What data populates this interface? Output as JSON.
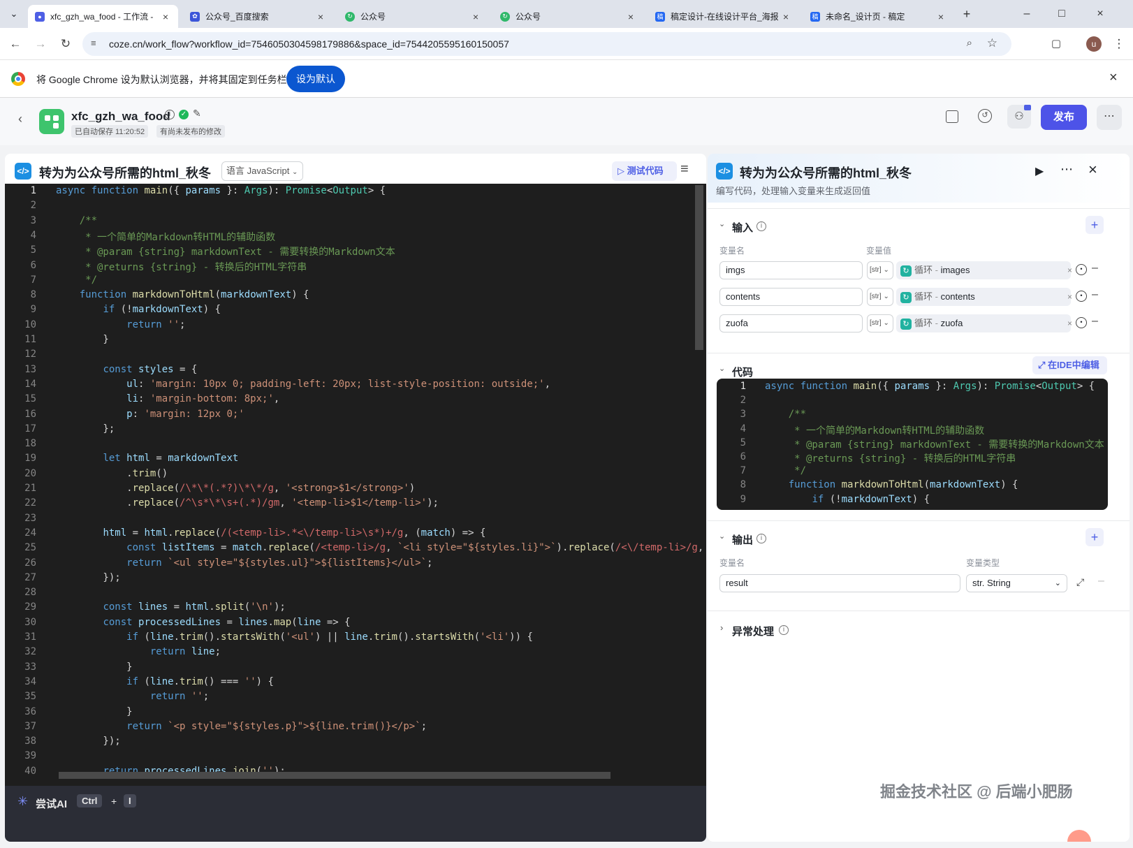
{
  "browser": {
    "tabs": [
      {
        "title": "xfc_gzh_wa_food - 工作流 - ",
        "active": true,
        "favicon": "coze-icon"
      },
      {
        "title": "公众号_百度搜索",
        "active": false,
        "favicon": "baidu-paw-icon"
      },
      {
        "title": "公众号",
        "active": false,
        "favicon": "wechat-loop-icon"
      },
      {
        "title": "公众号",
        "active": false,
        "favicon": "wechat-loop-icon"
      },
      {
        "title": "稿定设计-在线设计平台_海报",
        "active": false,
        "favicon": "gaoding-icon"
      },
      {
        "title": "未命名_设计页 - 稿定",
        "active": false,
        "favicon": "gaoding-icon"
      }
    ],
    "url": "coze.cn/work_flow?workflow_id=7546050304598179886&space_id=7544205595160150057",
    "profile_initial": "u",
    "infobar_text": "将 Google Chrome 设为默认浏览器，并将其固定到任务栏",
    "infobar_button": "设为默认"
  },
  "app": {
    "workflow_name": "xfc_gzh_wa_food",
    "autosave_text": "已自动保存 11:20:52",
    "unpublished_text": "有尚未发布的修改",
    "publish_label": "发布"
  },
  "editor": {
    "title": "转为为公众号所需的html_秋冬",
    "language_select": "语言 JavaScript",
    "test_button": "测试代码",
    "ai_label": "尝试AI",
    "shortcut_key1": "Ctrl",
    "shortcut_plus": "+",
    "shortcut_key2": "I",
    "line_numbers": [
      "1",
      "2",
      "3",
      "4",
      "5",
      "6",
      "7",
      "8",
      "9",
      "10",
      "11",
      "12",
      "13",
      "14",
      "15",
      "16",
      "17",
      "18",
      "19",
      "20",
      "21",
      "22",
      "23",
      "24",
      "25",
      "26",
      "27",
      "28",
      "29",
      "30",
      "31",
      "32",
      "33",
      "34",
      "35",
      "36",
      "37",
      "38",
      "39",
      "40"
    ],
    "code_lines": [
      "async function main({ params }: Args): Promise<Output> {",
      "",
      "    /**",
      "     * 一个简单的Markdown转HTML的辅助函数",
      "     * @param {string} markdownText - 需要转换的Markdown文本",
      "     * @returns {string} - 转换后的HTML字符串",
      "     */",
      "    function markdownToHtml(markdownText) {",
      "        if (!markdownText) {",
      "            return '';",
      "        }",
      "",
      "        const styles = {",
      "            ul: 'margin: 10px 0; padding-left: 20px; list-style-position: outside;',",
      "            li: 'margin-bottom: 8px;',",
      "            p: 'margin: 12px 0;'",
      "        };",
      "",
      "        let html = markdownText",
      "            .trim()",
      "            .replace(/\\*\\*(.*?)\\*\\*/g, '<strong>$1</strong>')",
      "            .replace(/^\\s*\\*\\s+(.*)/gm, '<temp-li>$1</temp-li>');",
      "",
      "        html = html.replace(/(<temp-li>.*<\\/temp-li>\\s*)+/g, (match) => {",
      "            const listItems = match.replace(/<temp-li>/g, `<li style=\"${styles.li}\">`).replace(/<\\/temp-li>/g,",
      "            return `<ul style=\"${styles.ul}\">${listItems}</ul>`;",
      "        });",
      "",
      "        const lines = html.split('\\n');",
      "        const processedLines = lines.map(line => {",
      "            if (line.trim().startsWith('<ul') || line.trim().startsWith('<li')) {",
      "                return line;",
      "            }",
      "            if (line.trim() === '') {",
      "                return '';",
      "            }",
      "            return `<p style=\"${styles.p}\">${line.trim()}</p>`;",
      "        });",
      "",
      "        return processedLines.join('');"
    ]
  },
  "node": {
    "title": "转为为公众号所需的html_秋冬",
    "description": "编写代码，处理输入变量来生成返回值",
    "input_section": "输入",
    "col_var_name": "变量名",
    "col_var_value": "变量值",
    "inputs": [
      {
        "name": "imgs",
        "type_tag": "[str]",
        "ref_prefix": "循环",
        "ref_var": "images"
      },
      {
        "name": "contents",
        "type_tag": "[str]",
        "ref_prefix": "循环",
        "ref_var": "contents"
      },
      {
        "name": "zuofa",
        "type_tag": "[str]",
        "ref_prefix": "循环",
        "ref_var": "zuofa"
      }
    ],
    "code_section": "代码",
    "ide_button": "在IDE中编辑",
    "mini_line_numbers": [
      "1",
      "2",
      "3",
      "4",
      "5",
      "6",
      "7",
      "8",
      "9"
    ],
    "output_section": "输出",
    "col_var_type": "变量类型",
    "outputs": [
      {
        "name": "result",
        "type": "str. String"
      }
    ],
    "error_section": "异常处理"
  },
  "watermark": "掘金技术社区 @ 后端小肥肠",
  "colors": {
    "accent": "#4e5fe5",
    "publish": "#4d53e8",
    "editor_bg": "#1e1e1e",
    "success": "#1fb85a"
  }
}
